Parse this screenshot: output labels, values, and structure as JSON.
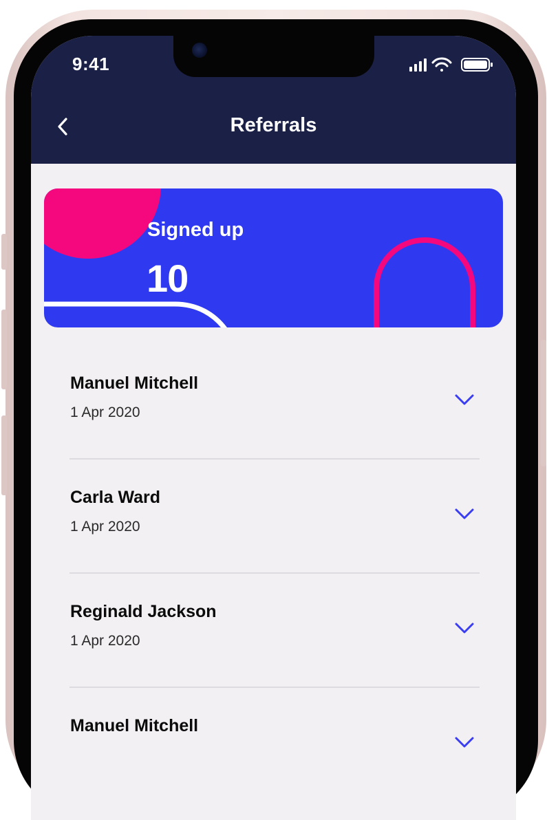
{
  "status_bar": {
    "time": "9:41"
  },
  "header": {
    "title": "Referrals",
    "back_icon": "chevron-left-icon"
  },
  "summary_card": {
    "label": "Signed up",
    "value": "10"
  },
  "referrals": [
    {
      "name": "Manuel Mitchell",
      "date": "1 Apr 2020"
    },
    {
      "name": "Carla Ward",
      "date": "1 Apr 2020"
    },
    {
      "name": "Reginald Jackson",
      "date": "1 Apr 2020"
    },
    {
      "name": "Manuel Mitchell",
      "date": ""
    }
  ],
  "colors": {
    "header_bg": "#1b2047",
    "card_bg": "#2f3af0",
    "accent_pink": "#f5087e",
    "chevron": "#3a3df0",
    "screen_bg": "#f2f0f2"
  }
}
